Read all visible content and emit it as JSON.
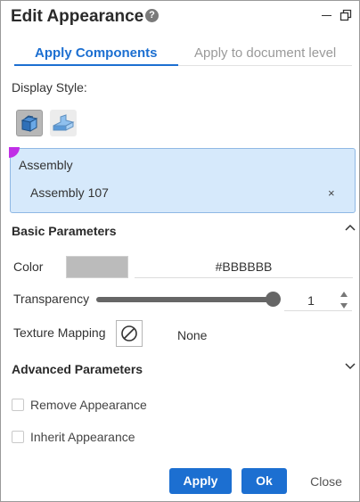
{
  "window": {
    "title": "Edit Appearance",
    "help_icon": "help-icon",
    "help_glyph": "?",
    "controls": [
      "minimize-icon",
      "restore-icon"
    ]
  },
  "tabs": [
    {
      "label": "Apply Components",
      "active": true
    },
    {
      "label": "Apply to document level",
      "active": false
    }
  ],
  "display_style": {
    "label": "Display Style:",
    "options": [
      {
        "icon": "shaded-with-edges-icon",
        "selected": true
      },
      {
        "icon": "shaded-icon",
        "selected": false
      }
    ]
  },
  "selection": {
    "label": "Assembly",
    "items": [
      {
        "name": "Assembly 107",
        "remove_glyph": "×"
      }
    ]
  },
  "basic_parameters": {
    "title": "Basic Parameters",
    "expanded": true,
    "color": {
      "label": "Color",
      "value": "#BBBBBB",
      "swatch": "#BBBBBB"
    },
    "transparency": {
      "label": "Transparency",
      "value": "1",
      "slider_fraction": 1.0
    },
    "texture_mapping": {
      "label": "Texture Mapping",
      "icon": "none-icon",
      "value": "None"
    }
  },
  "advanced_parameters": {
    "title": "Advanced Parameters",
    "expanded": false,
    "options": [
      {
        "label": "Remove Appearance",
        "checked": false
      },
      {
        "label": "Inherit Appearance",
        "checked": false
      }
    ]
  },
  "buttons": {
    "apply": "Apply",
    "ok": "Ok",
    "close": "Close"
  },
  "colors": {
    "accent": "#1C6FD1",
    "selection_bg": "#D6E9FB",
    "selection_marker": "#C02EE6",
    "slider": "#666666"
  }
}
